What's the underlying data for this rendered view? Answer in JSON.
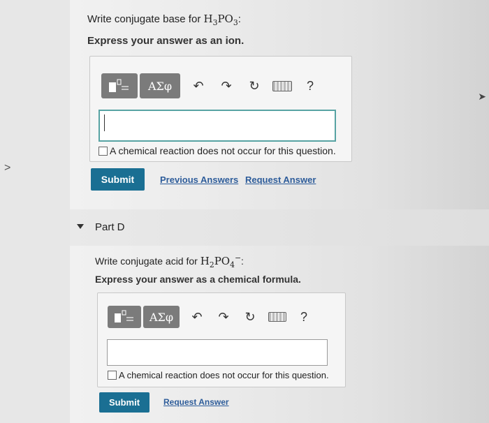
{
  "partC": {
    "question_prefix": "Write conjugate base for",
    "species": {
      "base": "H",
      "s1": "3",
      "mid": "PO",
      "s2": "3",
      "suffix": ":"
    },
    "instruction": "Express your answer as an ion.",
    "toolbar": {
      "greek": "ΑΣφ",
      "help": "?"
    },
    "input_value": "",
    "no_reaction_label": "A chemical reaction does not occur for this question.",
    "submit": "Submit",
    "previous_answers": "Previous Answers",
    "request_answer": "Request Answer"
  },
  "partD": {
    "title": "Part D",
    "question_prefix": "Write conjugate acid for",
    "species": {
      "base": "H",
      "s1": "2",
      "mid": "PO",
      "s2": "4",
      "sup": "−",
      "suffix": ":"
    },
    "instruction": "Express your answer as a chemical formula.",
    "toolbar": {
      "greek": "ΑΣφ",
      "help": "?"
    },
    "input_value": "",
    "no_reaction_label": "A chemical reaction does not occur for this question.",
    "submit": "Submit",
    "request_answer": "Request Answer"
  },
  "nav": {
    "left_arrow": ">",
    "right_arrow": "➤"
  }
}
